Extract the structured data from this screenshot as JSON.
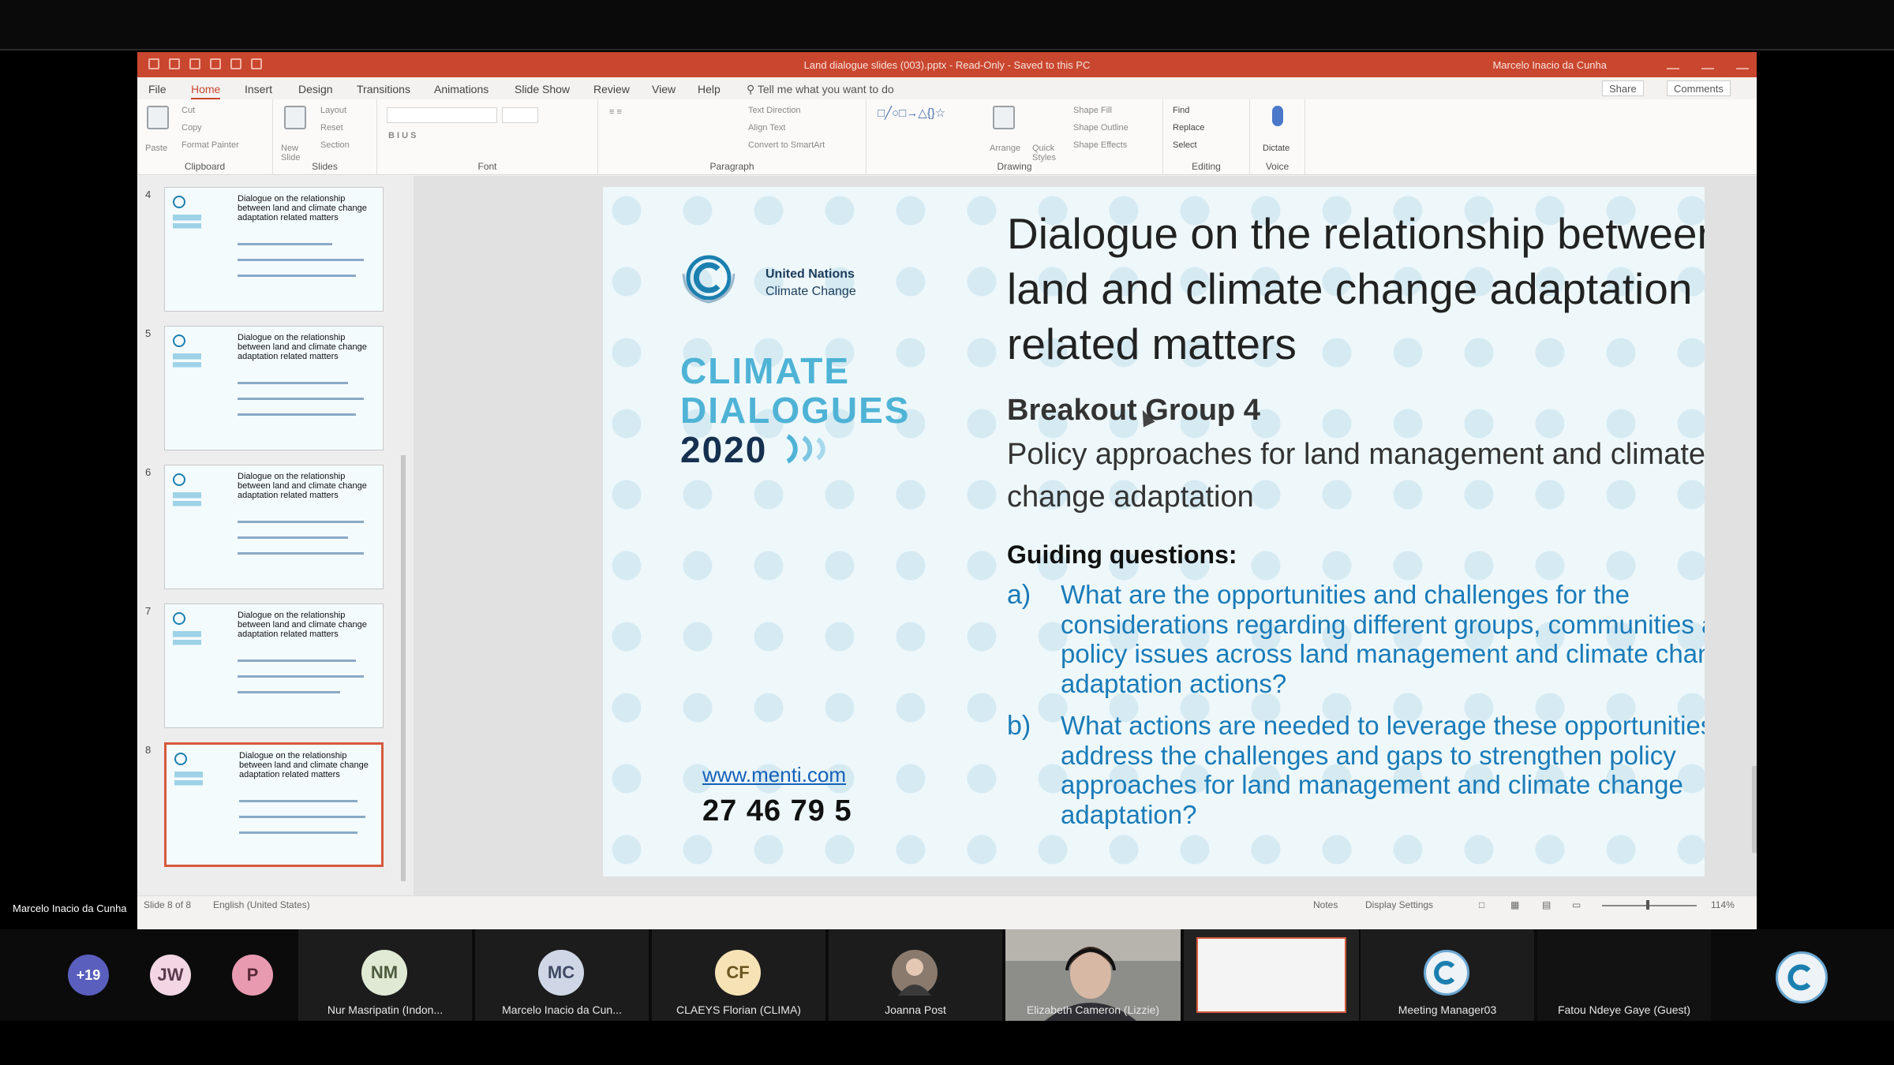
{
  "app": {
    "title": "Land dialogue slides (003).pptx - Read-Only - Saved to this PC",
    "user": "Marcelo Inacio da Cunha"
  },
  "menu": {
    "tabs": [
      "File",
      "Home",
      "Insert",
      "Design",
      "Transitions",
      "Animations",
      "Slide Show",
      "Review",
      "View",
      "Help"
    ],
    "tell_me": "Tell me what you want to do",
    "share": "Share",
    "comments": "Comments"
  },
  "ribbon": {
    "groups": [
      "Clipboard",
      "Slides",
      "Font",
      "Paragraph",
      "Drawing",
      "Editing",
      "Voice"
    ],
    "clipboard": {
      "paste": "Paste",
      "cut": "Cut",
      "copy": "Copy",
      "format_painter": "Format Painter"
    },
    "slides": {
      "new_slide": "New Slide",
      "layout": "Layout",
      "reset": "Reset",
      "section": "Section"
    },
    "paragraph": {
      "text_direction": "Text Direction",
      "align_text": "Align Text",
      "smartart": "Convert to SmartArt"
    },
    "drawing": {
      "arrange": "Arrange",
      "quick_styles": "Quick Styles",
      "shape_fill": "Shape Fill",
      "shape_outline": "Shape Outline",
      "shape_effects": "Shape Effects"
    },
    "editing": {
      "find": "Find",
      "replace": "Replace",
      "select": "Select"
    },
    "voice": {
      "dictate": "Dictate"
    }
  },
  "thumbnails": [
    {
      "num": "4",
      "title": "Dialogue on the relationship between land and climate change adaptation related matters"
    },
    {
      "num": "5",
      "title": "Dialogue on the relationship between land and climate change adaptation related matters"
    },
    {
      "num": "6",
      "title": "Dialogue on the relationship between land and climate change adaptation related matters"
    },
    {
      "num": "7",
      "title": "Dialogue on the relationship between land and climate change adaptation related matters"
    },
    {
      "num": "8",
      "title": "Dialogue on the relationship between land and climate change adaptation related matters"
    }
  ],
  "slide": {
    "un_line1": "United Nations",
    "un_line2": "Climate Change",
    "cd_line1": "CLIMATE",
    "cd_line2": "DIALOGUES",
    "cd_line3": "2020",
    "title": "Dialogue on the relationship between land and climate change adaptation related matters",
    "group": "Breakout Group 4",
    "subtitle": "Policy approaches for land management and climate change adaptation",
    "guiding": "Guiding questions:",
    "questions": [
      {
        "letter": "a)",
        "text": "What are the opportunities and challenges for the considerations regarding different groups, communities and policy issues across land management and climate change adaptation actions?"
      },
      {
        "letter": "b)",
        "text": "What actions are needed to leverage these opportunities and address the challenges and gaps to strengthen policy approaches for land management and climate change adaptation?"
      }
    ],
    "url": "www.menti.com",
    "code": "27 46 79 5"
  },
  "status": {
    "slide_of": "Slide 8 of 8",
    "language": "English (United States)",
    "notes": "Notes",
    "display_settings": "Display Settings",
    "zoom": "114%"
  },
  "meeting": {
    "presenter": "Marcelo Inacio da Cunha",
    "overflow_count": "+19",
    "avatars": [
      {
        "initials": "JW",
        "color": "#f2d6e4"
      },
      {
        "initials": "P",
        "color": "#e79ab0"
      }
    ],
    "participants": [
      {
        "initials": "NM",
        "name": "Nur Masripatin (Indon...",
        "color": "#dfe9d4"
      },
      {
        "initials": "MC",
        "name": "Marcelo Inacio da Cun...",
        "color": "#cfd7e6"
      },
      {
        "initials": "CF",
        "name": "CLAEYS Florian (CLIMA)",
        "color": "#f5e3b5"
      },
      {
        "name": "Joanna Post"
      },
      {
        "name": "Elizabeth Cameron (Lizzie)"
      },
      {
        "name": "Meeting Manager03"
      },
      {
        "name": "Fatou Ndeye Gaye (Guest)"
      }
    ]
  },
  "colors": {
    "accent": "#c9472f",
    "climate_light": "#4fb3d6",
    "climate_dark": "#16314f",
    "question_blue": "#1a7bb8"
  }
}
